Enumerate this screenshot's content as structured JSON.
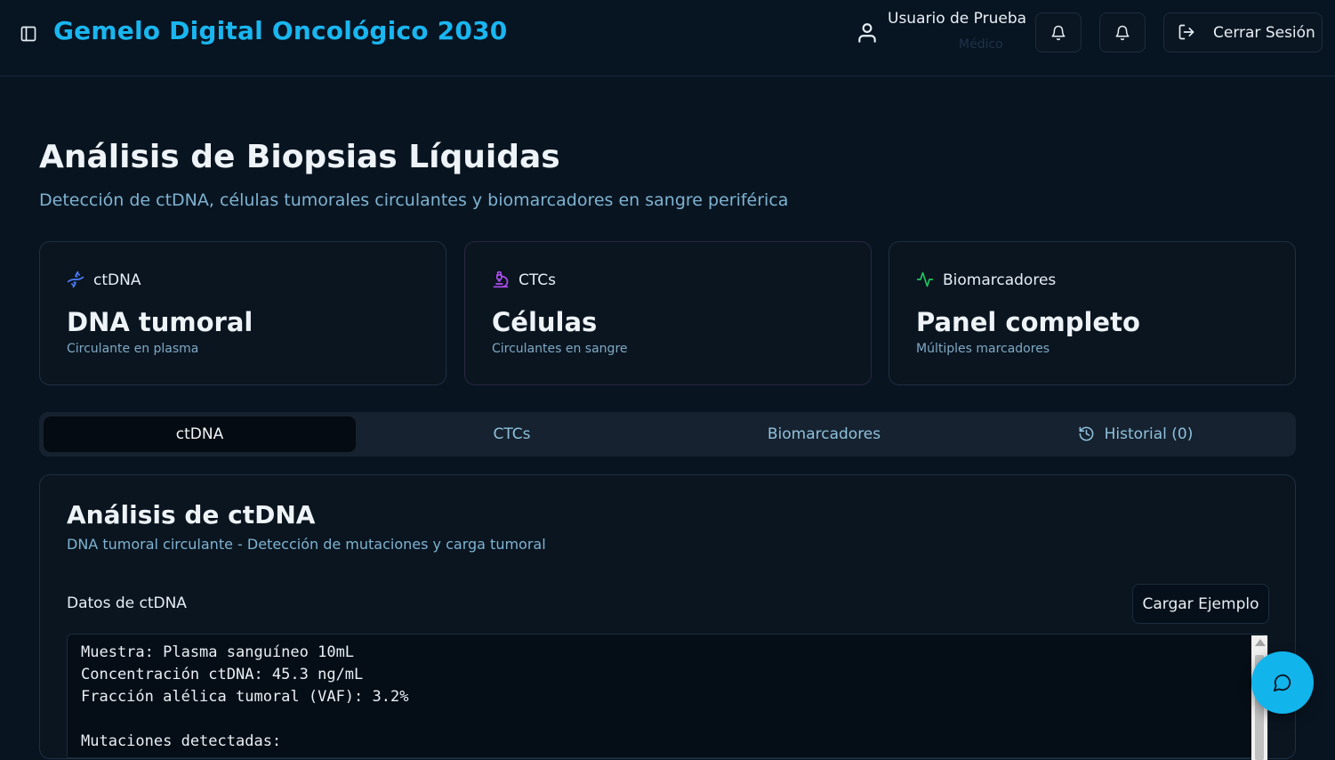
{
  "header": {
    "title": "Gemelo Digital Oncológico 2030",
    "user_name": "Usuario de Prueba",
    "user_role": "Médico",
    "logout_label": "Cerrar Sesión"
  },
  "page": {
    "title": "Análisis de Biopsias Líquidas",
    "subtitle": "Detección de ctDNA, células tumorales circulantes y biomarcadores en sangre periférica"
  },
  "cards": [
    {
      "label": "ctDNA",
      "value": "DNA tumoral",
      "description": "Circulante en plasma",
      "icon": "dna-icon"
    },
    {
      "label": "CTCs",
      "value": "Células",
      "description": "Circulantes en sangre",
      "icon": "microscope-icon"
    },
    {
      "label": "Biomarcadores",
      "value": "Panel completo",
      "description": "Múltiples marcadores",
      "icon": "activity-icon"
    }
  ],
  "tabs": [
    {
      "label": "ctDNA",
      "active": true
    },
    {
      "label": "CTCs",
      "active": false
    },
    {
      "label": "Biomarcadores",
      "active": false
    },
    {
      "label": "Historial (0)",
      "active": false,
      "icon": "history-icon"
    }
  ],
  "panel": {
    "title": "Análisis de ctDNA",
    "subtitle": "DNA tumoral circulante - Detección de mutaciones y carga tumoral",
    "field_label": "Datos de ctDNA",
    "load_button": "Cargar Ejemplo",
    "textarea_lines": "Muestra: Plasma sanguíneo 10mL\nConcentración ctDNA: 45.3 ng/mL\nFracción alélica tumoral (VAF): 3.2%\n\nMutaciones detectadas:"
  },
  "colors": {
    "accent": "#19b6f0",
    "background": "#081521",
    "card_border": "#1f2f40",
    "chat_fab": "#12b4ec"
  }
}
